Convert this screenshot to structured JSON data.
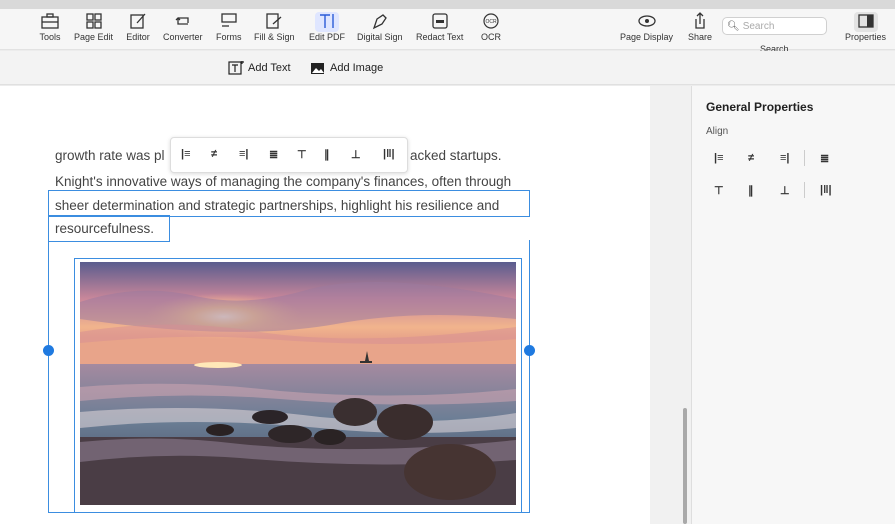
{
  "toolbar": {
    "tools": [
      {
        "label": "Tools"
      },
      {
        "label": "Page Edit"
      },
      {
        "label": "Editor"
      },
      {
        "label": "Converter"
      },
      {
        "label": "Forms"
      },
      {
        "label": "Fill & Sign"
      },
      {
        "label": "Edit PDF"
      },
      {
        "label": "Digital Sign"
      },
      {
        "label": "Redact Text"
      },
      {
        "label": "OCR"
      }
    ],
    "right_tools": [
      {
        "label": "Page Display"
      },
      {
        "label": "Share"
      },
      {
        "label": "Search"
      },
      {
        "label": "Properties"
      }
    ],
    "search_placeholder": "Search",
    "active_tool": "Edit PDF"
  },
  "subbar": {
    "add_text": "Add Text",
    "add_image": "Add Image"
  },
  "document": {
    "line1_left": "growth rate was pl",
    "line1_right": "acked startups.",
    "line2": "Knight's innovative ways of managing the company's finances, often through",
    "line3": "sheer determination and strategic partnerships, highlight his resilience and",
    "line4": "resourcefulness."
  },
  "panel": {
    "title": "General Properties",
    "align_label": "Align"
  },
  "colors": {
    "accent": "#1f7ae0",
    "selection": "#3b8de0"
  }
}
